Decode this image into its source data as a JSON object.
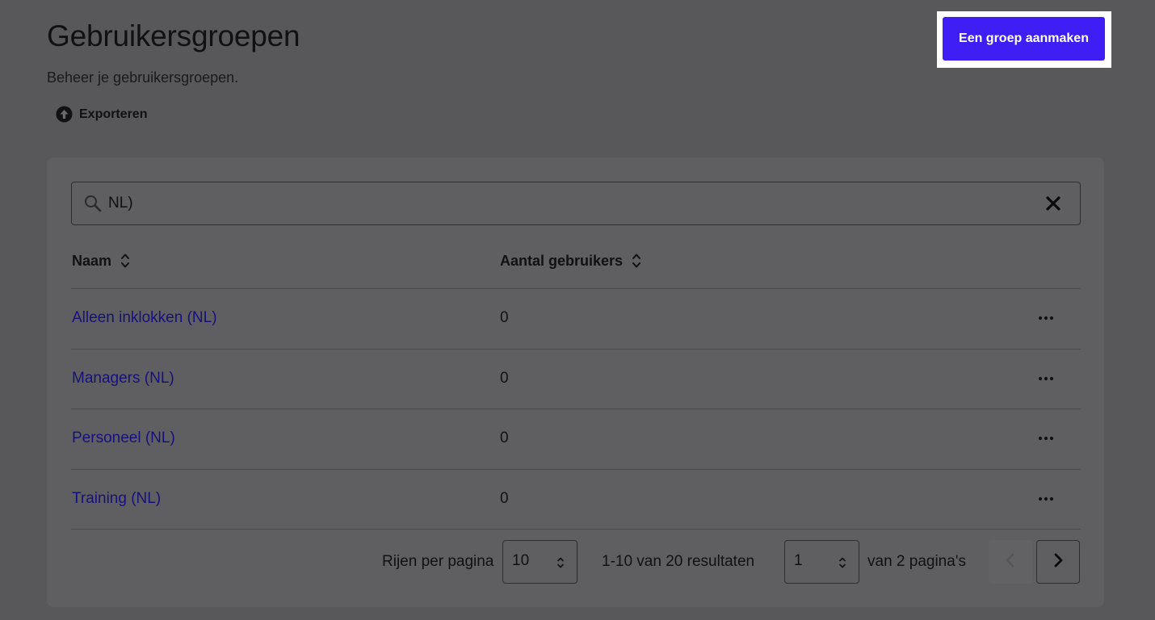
{
  "header": {
    "title": "Gebruikersgroepen",
    "subtitle": "Beheer je gebruikersgroepen.",
    "export_label": "Exporteren",
    "create_button_label": "Een groep aanmaken"
  },
  "search": {
    "value": "NL)",
    "search_icon": "search-icon",
    "clear_icon": "close-icon"
  },
  "table": {
    "columns": [
      "Naam",
      "Aantal gebruikers"
    ],
    "rows": [
      {
        "name": "Alleen inklokken (NL)",
        "count": "0"
      },
      {
        "name": "Managers (NL)",
        "count": "0"
      },
      {
        "name": "Personeel (NL)",
        "count": "0"
      },
      {
        "name": "Training (NL)",
        "count": "0"
      }
    ]
  },
  "pagination": {
    "rows_per_page_label": "Rijen per pagina",
    "rows_per_page_value": "10",
    "results_text": "1-10 van 20 resultaten",
    "current_page": "1",
    "total_pages_text": "van 2 pagina's"
  },
  "colors": {
    "primary_button": "#3e1ef5",
    "link": "#17107a",
    "overlay_background": "#58585b"
  }
}
